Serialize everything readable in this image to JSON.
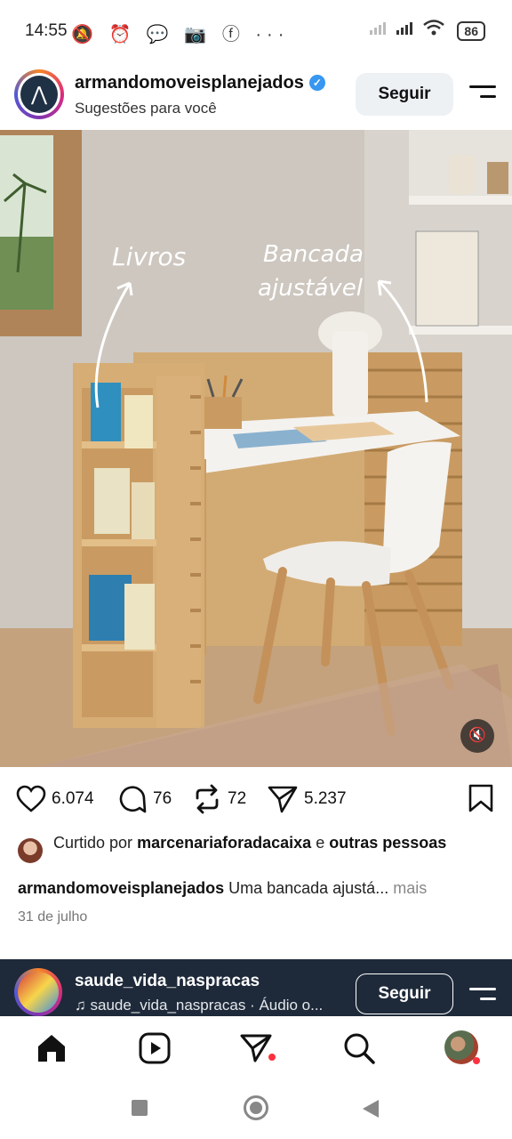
{
  "status_bar": {
    "time": "14:55",
    "left_icons": "🔕 ⏰ 💬 📷 ⓕ ···",
    "battery": "86"
  },
  "post": {
    "username": "armandomoveisplanejados",
    "subtitle": "Sugestões para você",
    "follow_label": "Seguir",
    "image_annotations": {
      "left": "Livros",
      "right_line1": "Bancada",
      "right_line2": "ajustável"
    },
    "stats": {
      "likes": "6.074",
      "comments": "76",
      "reposts": "72",
      "shares": "5.237"
    },
    "liked_by_prefix": "Curtido por",
    "liked_by_user": "marcenariaforadacaixa",
    "liked_by_suffix": "e",
    "liked_by_others": "outras pessoas",
    "caption_user": "armandomoveisplanejados",
    "caption_text": "Uma bancada ajustá...",
    "caption_more": "mais",
    "date": "31 de julho"
  },
  "next_post": {
    "username": "saude_vida_naspracas",
    "audio": "saude_vida_naspracas · Áudio o...",
    "follow_label": "Seguir"
  },
  "icons": {
    "nav": [
      "home-icon",
      "reels-icon",
      "direct-icon",
      "search-icon",
      "profile-avatar"
    ],
    "actions": [
      "heart-icon",
      "comment-icon",
      "repost-icon",
      "share-icon",
      "bookmark-icon"
    ]
  }
}
